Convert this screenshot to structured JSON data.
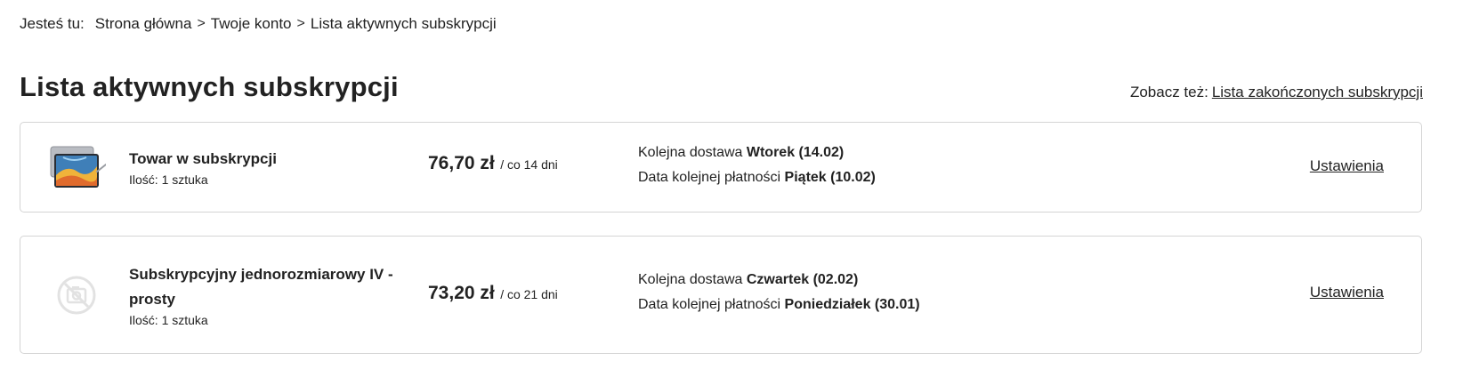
{
  "breadcrumb": {
    "prefix": "Jesteś tu:",
    "items": [
      "Strona główna",
      "Twoje konto",
      "Lista aktywnych subskrypcji"
    ],
    "separator": ">"
  },
  "page_title": "Lista aktywnych subskrypcji",
  "see_also": {
    "label": "Zobacz też:",
    "link_text": "Lista zakończonych subskrypcji"
  },
  "subscriptions": [
    {
      "image": "tablet-image",
      "name": "Towar w subskrypcji",
      "quantity": "Ilość: 1 sztuka",
      "price": "76,70 zł",
      "period": "/ co 14 dni",
      "delivery_label": "Kolejna dostawa",
      "delivery_value": "Wtorek (14.02)",
      "payment_label": "Data kolejnej płatności",
      "payment_value": "Piątek (10.02)",
      "settings_label": "Ustawienia"
    },
    {
      "image": "no-image-icon",
      "name": "Subskrypcyjny jednorozmiarowy IV - prosty",
      "quantity": "Ilość: 1 sztuka",
      "price": "73,20 zł",
      "period": "/ co 21 dni",
      "delivery_label": "Kolejna dostawa",
      "delivery_value": "Czwartek (02.02)",
      "payment_label": "Data kolejnej płatności",
      "payment_value": "Poniedziałek (30.01)",
      "settings_label": "Ustawienia"
    }
  ]
}
